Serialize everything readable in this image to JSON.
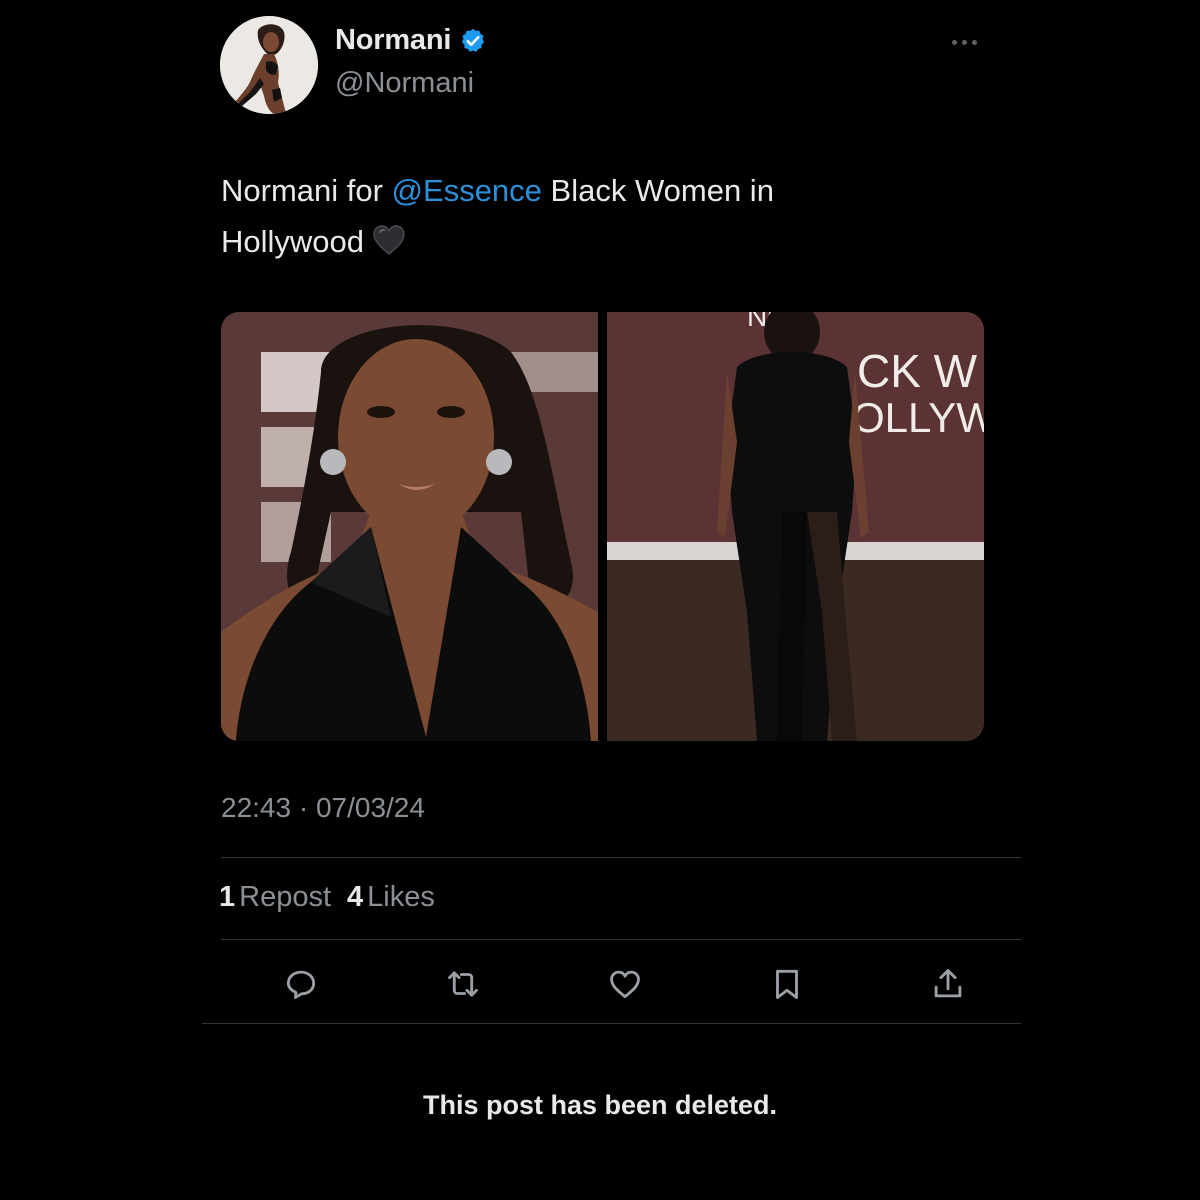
{
  "author": {
    "display_name": "Normani",
    "handle": "@Normani",
    "verified": true,
    "avatar_icon": "avatar-photo"
  },
  "tweet": {
    "text_prefix": "Normani for ",
    "mention": "@Essence",
    "text_suffix": " Black Women in Hollywood",
    "emoji": "black-heart",
    "timestamp": "22:43 · 07/03/24"
  },
  "media": {
    "photos": [
      {
        "icon": "portrait-photo"
      },
      {
        "icon": "red-carpet-photo",
        "backdrop_text": [
          "NCE",
          "CK W",
          "OLLYW"
        ]
      }
    ]
  },
  "stats": {
    "reposts_count": "1",
    "reposts_label": "Repost",
    "likes_count": "4",
    "likes_label": "Likes"
  },
  "actions": [
    "reply-icon",
    "repost-icon",
    "like-icon",
    "bookmark-icon",
    "share-icon"
  ],
  "footer": {
    "notice": "This post has been deleted."
  },
  "colors": {
    "background": "#000000",
    "text": "#e7e9ea",
    "secondary": "#8b9096",
    "mention": "#2b8fd9",
    "verified": "#1d9bf0",
    "divider": "#2f3336"
  }
}
